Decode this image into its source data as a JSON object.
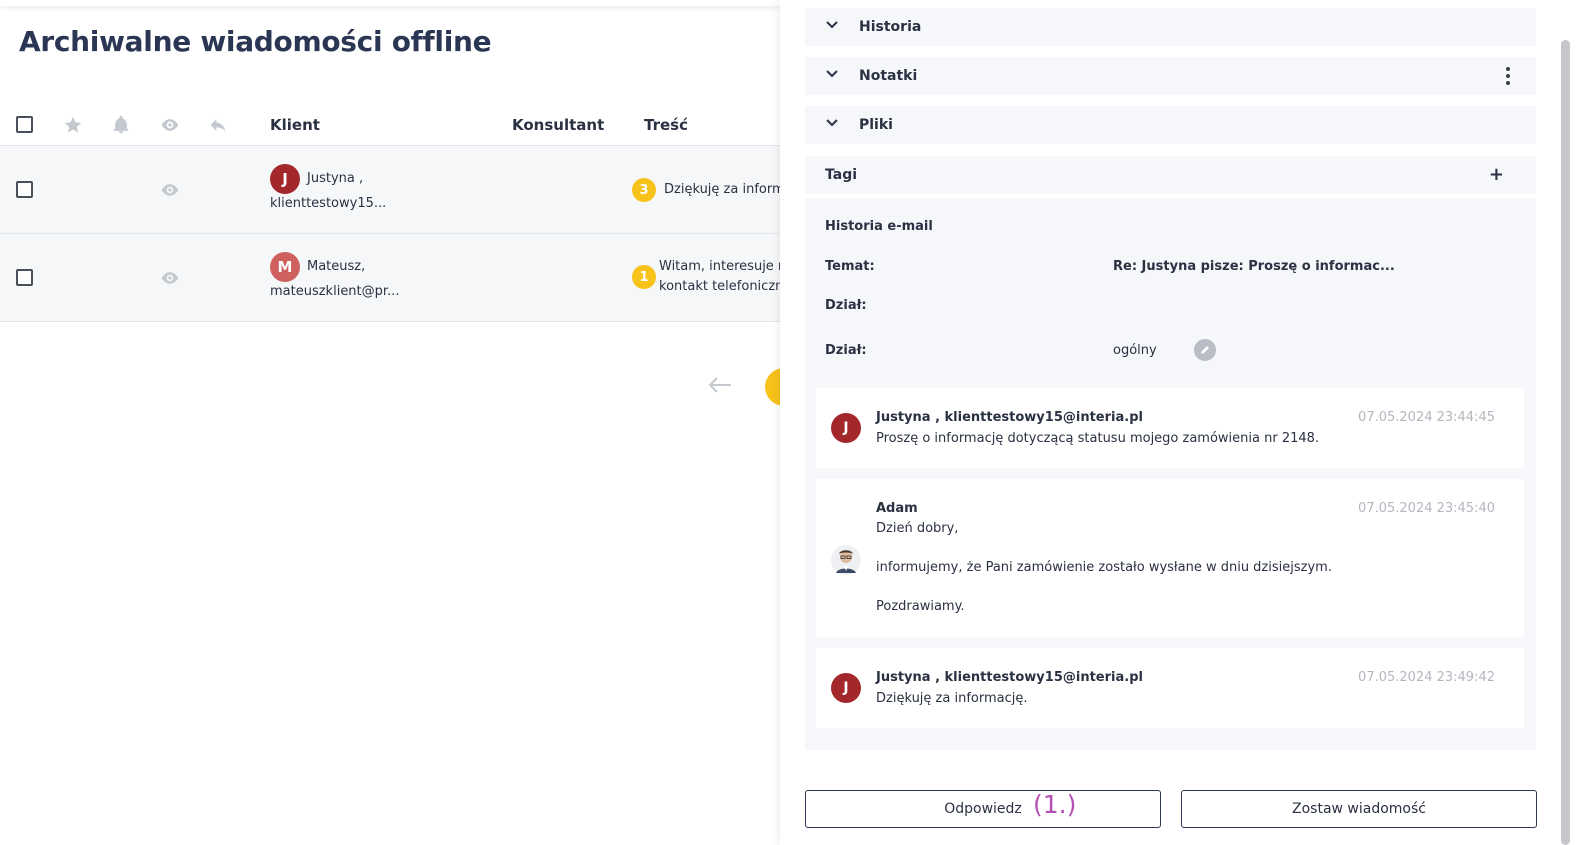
{
  "page": {
    "title": "Archiwalne wiadomości offline"
  },
  "table": {
    "headers": {
      "client": "Klient",
      "consultant": "Konsultant",
      "content": "Treść"
    },
    "rows": [
      {
        "avatar_letter": "J",
        "avatar_color": "#a3282c",
        "client_name": "Justyna ,",
        "client_email": "klienttestowy15...",
        "badge": "3",
        "content_line1": "Dziękuję za informa",
        "content_line2": ""
      },
      {
        "avatar_letter": "M",
        "avatar_color": "#d0605e",
        "client_name": "Mateusz,",
        "client_email": "mateuszklient@pr...",
        "badge": "1",
        "content_line1": "Witam, interesuje m",
        "content_line2": "kontakt telefoniczny"
      }
    ]
  },
  "pager": {
    "prev_icon": "arrow-left-icon"
  },
  "panel": {
    "sections": {
      "history": "Historia",
      "notes": "Notatki",
      "files": "Pliki",
      "tags": "Tagi"
    },
    "email": {
      "heading": "Historia e-mail",
      "subject_label": "Temat:",
      "subject_value": "Re: Justyna pisze: Proszę o informac...",
      "dept_label_1": "Dział:",
      "dept_label_2": "Dział:",
      "dept_value": "ogólny"
    },
    "messages": [
      {
        "author": "Justyna , klienttestowy15@interia.pl",
        "date": "07.05.2024 23:44:45",
        "avatar_letter": "J",
        "lines": [
          "Proszę o informację dotyczącą statusu mojego zamówienia nr 2148."
        ]
      },
      {
        "author": "Adam",
        "date": "07.05.2024 23:45:40",
        "lines": [
          "Dzień dobry,",
          "informujemy, że Pani zamówienie zostało wysłane w dniu dzisiejszym.",
          "Pozdrawiamy."
        ]
      },
      {
        "author": "Justyna , klienttestowy15@interia.pl",
        "date": "07.05.2024 23:49:42",
        "avatar_letter": "J",
        "lines": [
          "Dziękuję za informację."
        ]
      }
    ],
    "buttons": {
      "reply": "Odpowiedz",
      "leave_message": "Zostaw wiadomość"
    },
    "annotation": "(1.)"
  }
}
